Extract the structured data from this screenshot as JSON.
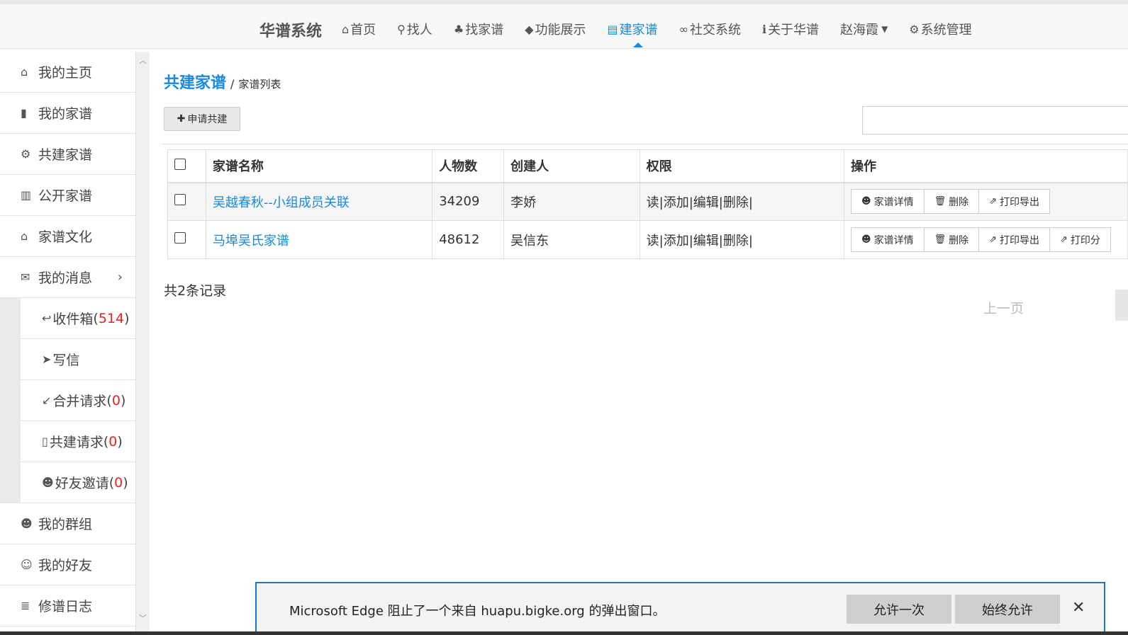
{
  "header": {
    "brand": "华谱系统",
    "nav": [
      {
        "icon": "home-icon",
        "glyph": "⌂",
        "label": "首页"
      },
      {
        "icon": "search-icon",
        "glyph": "⚲",
        "label": "找人"
      },
      {
        "icon": "tree-icon",
        "glyph": "♣",
        "label": "找家谱"
      },
      {
        "icon": "tags-icon",
        "glyph": "◆",
        "label": "功能展示"
      },
      {
        "icon": "book-icon",
        "glyph": "▤",
        "label": "建家谱"
      },
      {
        "icon": "link-icon",
        "glyph": "∞",
        "label": "社交系统"
      },
      {
        "icon": "info-icon",
        "glyph": "ℹ",
        "label": "关于华谱"
      },
      {
        "icon": "user-menu-icon",
        "glyph": "",
        "label": "赵海霞"
      },
      {
        "icon": "gears-icon",
        "glyph": "⚙",
        "label": "系统管理"
      }
    ],
    "active_index": 4
  },
  "sidebar": {
    "items": [
      {
        "icon": "home-icon",
        "glyph": "⌂",
        "label": "我的主页"
      },
      {
        "icon": "file-icon",
        "glyph": "▮",
        "label": "我的家谱"
      },
      {
        "icon": "gears-icon",
        "glyph": "⚙",
        "label": "共建家谱"
      },
      {
        "icon": "book-open-icon",
        "glyph": "▥",
        "label": "公开家谱"
      },
      {
        "icon": "bank-icon",
        "glyph": "⌂",
        "label": "家谱文化"
      },
      {
        "icon": "comments-icon",
        "glyph": "✉",
        "label": "我的消息"
      }
    ],
    "sub_items": [
      {
        "icon": "reply-icon",
        "glyph": "↩",
        "label": "收件箱",
        "count": "514"
      },
      {
        "icon": "send-icon",
        "glyph": "➤",
        "label": "写信",
        "count": ""
      },
      {
        "icon": "compress-icon",
        "glyph": "↙",
        "label": "合并请求",
        "count": "0"
      },
      {
        "icon": "file-o-icon",
        "glyph": "▯",
        "label": "共建请求",
        "count": "0"
      },
      {
        "icon": "user-plus-icon",
        "glyph": "☻",
        "label": "好友邀请",
        "count": "0"
      }
    ],
    "bottom_items": [
      {
        "icon": "users-icon",
        "glyph": "☻",
        "label": "我的群组"
      },
      {
        "icon": "user-icon",
        "glyph": "☺",
        "label": "我的好友"
      },
      {
        "icon": "database-icon",
        "glyph": "≣",
        "label": "修谱日志"
      }
    ]
  },
  "main": {
    "breadcrumb_main": "共建家谱",
    "breadcrumb_sep": "/",
    "breadcrumb_sub": "家谱列表",
    "apply_button": "申请共建",
    "columns": [
      "家谱名称",
      "人物数",
      "创建人",
      "权限",
      "操作"
    ],
    "rows": [
      {
        "name": "吴越春秋--小组成员关联",
        "count": "34209",
        "creator": "李娇",
        "perm": "读|添加|编辑|删除|",
        "ops": [
          "家谱详情",
          "删除",
          "打印导出"
        ]
      },
      {
        "name": "马埠吴氏家谱",
        "count": "48612",
        "creator": "吴信东",
        "perm": "读|添加|编辑|删除|",
        "ops": [
          "家谱详情",
          "删除",
          "打印导出",
          "打印分"
        ]
      }
    ],
    "total": "共2条记录",
    "prev_page": "上一页"
  },
  "popup": {
    "message": "Microsoft Edge 阻止了一个来自 huapu.bigke.org 的弹出窗口。",
    "allow_once": "允许一次",
    "always_allow": "始终允许",
    "close": "✕"
  }
}
